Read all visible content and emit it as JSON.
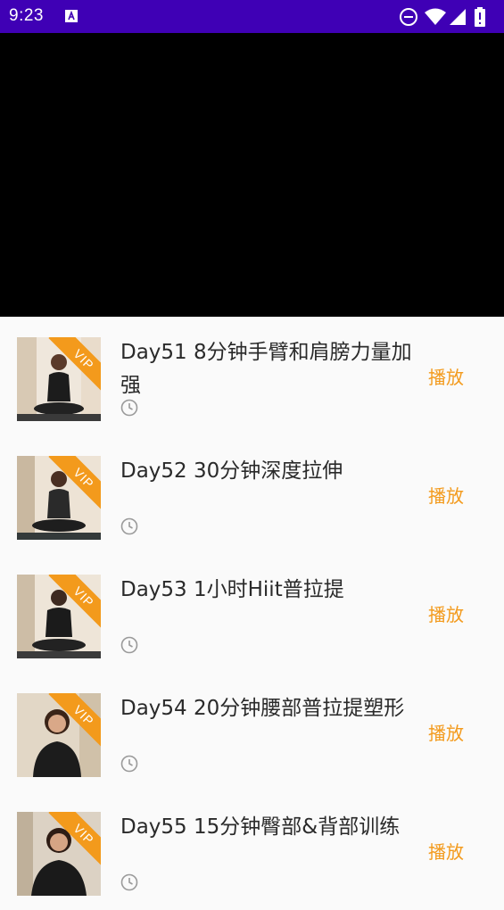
{
  "status_bar": {
    "time": "9:23",
    "icons": [
      "text-badge-icon",
      "do-not-disturb-icon",
      "wifi-icon",
      "signal-icon",
      "battery-icon"
    ],
    "background": "#3f00b5"
  },
  "video_player": {
    "background": "#000000"
  },
  "accent_color": "#f39a1c",
  "items": [
    {
      "title": "Day51 8分钟手臂和肩膀力量加强",
      "badge": "VIP",
      "action": "播放"
    },
    {
      "title": "Day52 30分钟深度拉伸",
      "badge": "VIP",
      "action": "播放"
    },
    {
      "title": "Day53 1小时Hiit普拉提",
      "badge": "VIP",
      "action": "播放"
    },
    {
      "title": "Day54 20分钟腰部普拉提塑形",
      "badge": "VIP",
      "action": "播放"
    },
    {
      "title": "Day55 15分钟臀部&背部训练",
      "badge": "VIP",
      "action": "播放"
    }
  ]
}
